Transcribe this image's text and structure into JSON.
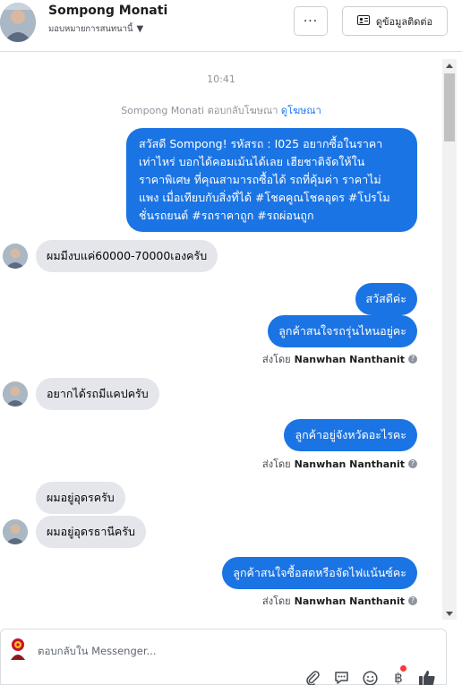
{
  "header": {
    "name": "Sompong Monati",
    "assign_label": "มอบหมายการสนทนานี้",
    "more_label": "···",
    "contact_label": "ดูข้อมูลติดต่อ"
  },
  "thread": {
    "timestamp": "10:41",
    "reply_note_prefix": "Sompong Monati ตอบกลับโฆษณา",
    "reply_note_link": "ดูโฆษณา",
    "messages": [
      {
        "lines": [
          "สวัสดี Sompong! รหัสรถ : I025 อยากซื้อในราคา",
          "เท่าไหร่ บอกได้คอมเม้นได้เลย เฮียชาติจัดให้ใน",
          "ราคาพิเศษ ที่คุณสามารถซื้อได้ รถที่คุ้มค่า ราคาไม่",
          "แพง เมื่อเทียบกับสิ่งที่ได้ #โชคคูณโชคอุดร #โปรโม",
          "ชั่นรถยนต์ #รถราคาถูก #รถผ่อนถูก"
        ]
      },
      {
        "text": "ผมมีงบแค่60000-70000เองครับ"
      },
      {
        "text": "สวัสดีค่ะ"
      },
      {
        "text": "ลูกค้าสนใจรถรุ่นไหนอยู่คะ"
      },
      {
        "text": "อยากได้รถมีแคปครับ"
      },
      {
        "text": "ลูกค้าอยู่จังหวัดอะไรคะ"
      },
      {
        "text": "ผมอยู่อุดรครับ"
      },
      {
        "text": "ผมอยู่อุดรธานีครับ"
      },
      {
        "text": "ลูกค้าสนใจซื้อสดหรือจัดไฟแน้นซ์คะ"
      }
    ],
    "sent_by_label": "ส่งโดย",
    "sent_by_name": "Nanwhan Nanthanit"
  },
  "composer": {
    "placeholder": "ตอบกลับใน Messenger...",
    "tools": [
      "paperclip-icon",
      "saved-reply-icon",
      "emoji-icon",
      "baht-icon",
      "thumbs-up-icon"
    ]
  },
  "colors": {
    "outgoing": "#1b74e4",
    "incoming": "#e4e6eb",
    "link": "#1877f2"
  }
}
